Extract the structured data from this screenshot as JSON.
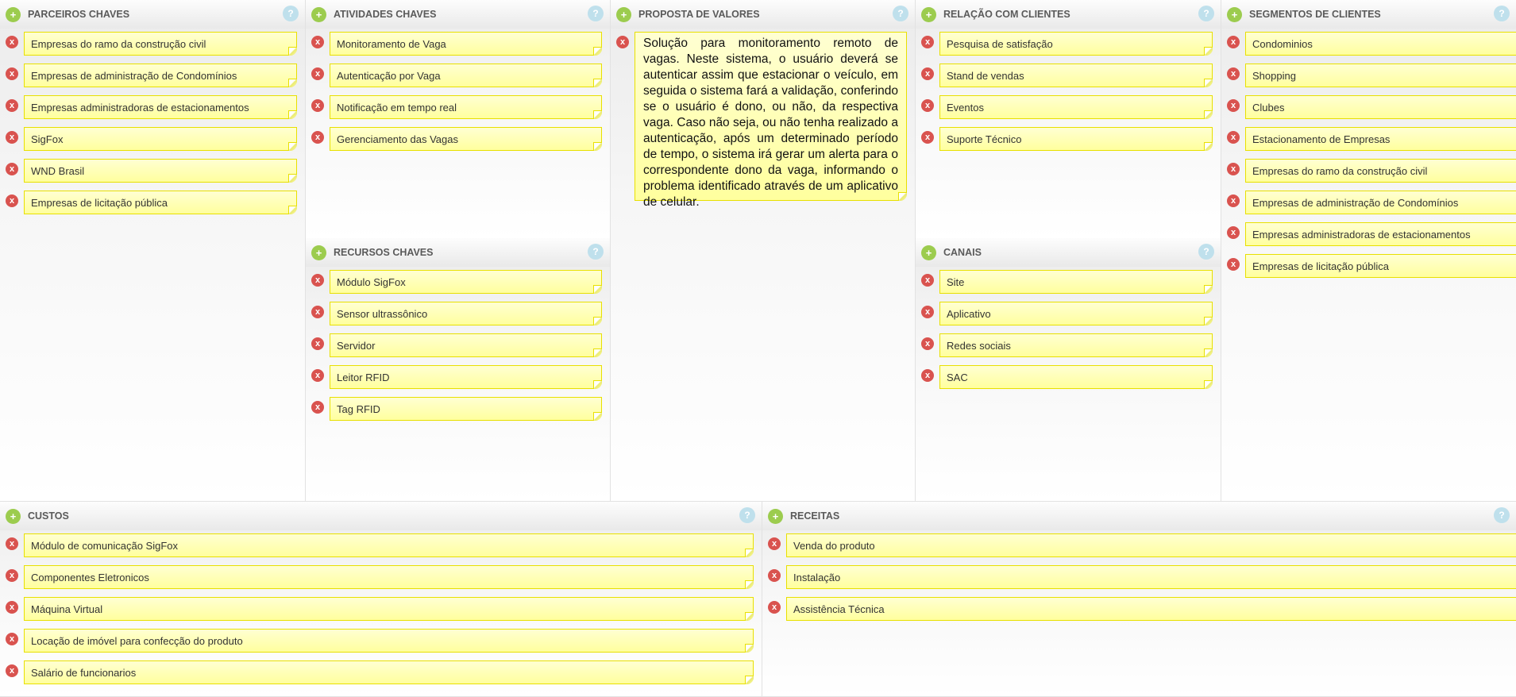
{
  "blocks": {
    "parceiros": {
      "title": "PARCEIROS CHAVES",
      "items": [
        "Empresas do ramo da construção civil",
        "Empresas de administração de Condomínios",
        "Empresas administradoras de estacionamentos",
        "SigFox",
        "WND Brasil",
        "Empresas de licitação pública"
      ]
    },
    "atividades": {
      "title": "ATIVIDADES CHAVES",
      "items": [
        "Monitoramento de Vaga",
        "Autenticação por Vaga",
        "Notificação em tempo real",
        "Gerenciamento das Vagas"
      ]
    },
    "recursos": {
      "title": "RECURSOS CHAVES",
      "items": [
        "Módulo SigFox",
        "Sensor ultrassônico",
        "Servidor",
        "Leitor RFID",
        "Tag RFID"
      ]
    },
    "proposta": {
      "title": "PROPOSTA DE VALORES",
      "items": [
        "Solução para monitoramento remoto de vagas. Neste sistema, o usuário deverá se autenticar assim que estacionar o veículo, em seguida o sistema fará a validação, conferindo se o usuário é dono, ou não, da respectiva vaga. Caso não seja, ou não tenha realizado a autenticação, após um determinado período de tempo, o sistema irá gerar um alerta para o correspondente dono da vaga, informando o problema identificado através de um aplicativo de celular."
      ]
    },
    "relacao": {
      "title": "RELAÇÃO COM CLIENTES",
      "items": [
        "Pesquisa de satisfação",
        "Stand de vendas",
        "Eventos",
        "Suporte Técnico"
      ]
    },
    "canais": {
      "title": "CANAIS",
      "items": [
        "Site",
        "Aplicativo",
        "Redes sociais",
        "SAC"
      ]
    },
    "segmentos": {
      "title": "SEGMENTOS DE CLIENTES",
      "items": [
        "Condominios",
        "Shopping",
        "Clubes",
        "Estacionamento de Empresas",
        "Empresas do ramo da construção civil",
        "Empresas de administração de Condomínios",
        "Empresas administradoras de estacionamentos",
        "Empresas de licitação pública"
      ]
    },
    "custos": {
      "title": "CUSTOS",
      "items": [
        "Módulo de comunicação SigFox",
        "Componentes Eletronicos",
        "Máquina Virtual",
        "Locação de imóvel para confecção do produto",
        "Salário de funcionarios"
      ]
    },
    "receitas": {
      "title": "RECEITAS",
      "items": [
        "Venda do produto",
        "Instalação",
        "Assistência Técnica"
      ]
    }
  },
  "icons": {
    "add": "+",
    "help": "?",
    "delete": "x"
  },
  "colors": {
    "add": "#9ccc4e",
    "help": "#bfe0ec",
    "delete": "#d9534f",
    "note_border": "#e8e000",
    "note_fill": "#ffffb0"
  }
}
